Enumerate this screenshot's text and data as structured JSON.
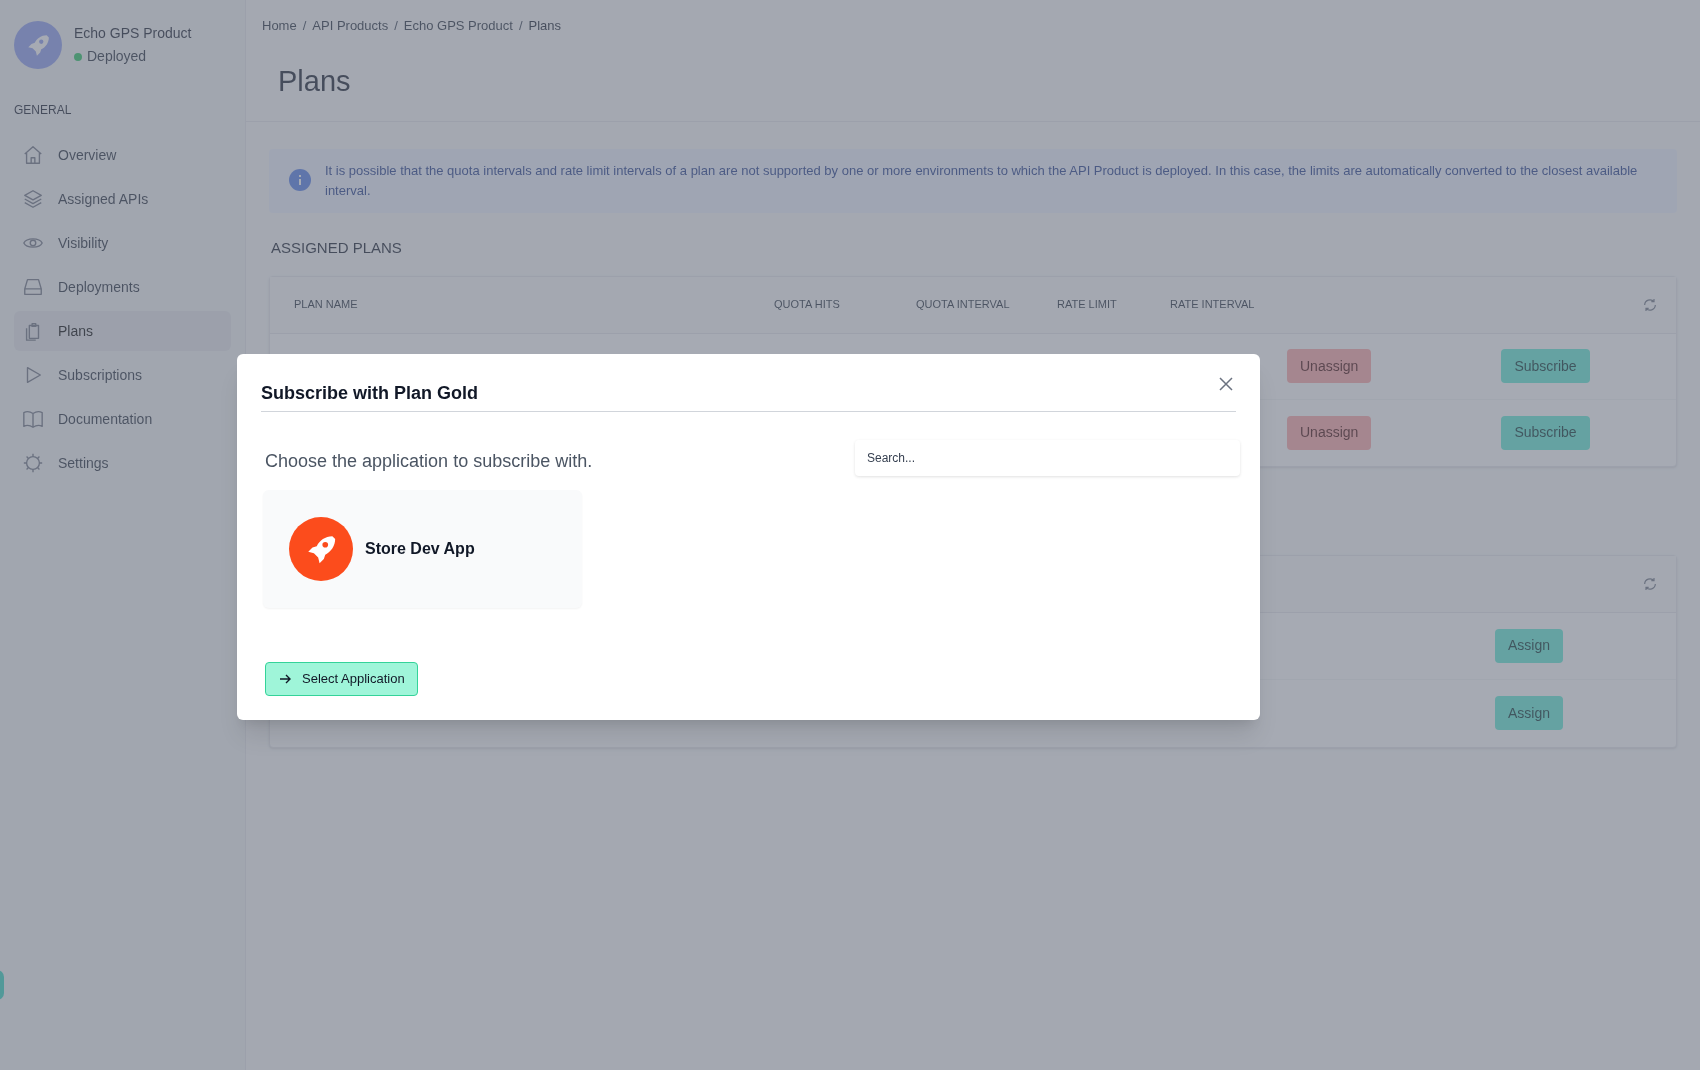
{
  "product": {
    "name": "Echo GPS Product",
    "status": "Deployed"
  },
  "sidebar": {
    "section": "GENERAL",
    "items": [
      {
        "label": "Overview",
        "selected": false
      },
      {
        "label": "Assigned APIs",
        "selected": false
      },
      {
        "label": "Visibility",
        "selected": false
      },
      {
        "label": "Deployments",
        "selected": false
      },
      {
        "label": "Plans",
        "selected": true
      },
      {
        "label": "Subscriptions",
        "selected": false
      },
      {
        "label": "Documentation",
        "selected": false
      },
      {
        "label": "Settings",
        "selected": false
      }
    ]
  },
  "breadcrumb": [
    {
      "text": "Home",
      "kind": "link"
    },
    {
      "text": "/",
      "kind": "separator"
    },
    {
      "text": "API Products",
      "kind": "link"
    },
    {
      "text": "/",
      "kind": "separator"
    },
    {
      "text": "Echo GPS Product",
      "kind": "link"
    },
    {
      "text": "/",
      "kind": "separator"
    },
    {
      "text": "Plans",
      "kind": "current"
    }
  ],
  "page_title": "Plans",
  "info": "It is possible that the quota intervals and rate limit intervals of a plan are not supported by one or more environments to which the API Product is deployed. In this case, the limits are automatically converted to the closest available interval.",
  "assigned_plans": {
    "title": "ASSIGNED PLANS",
    "columns": [
      "PLAN NAME",
      "QUOTA HITS",
      "QUOTA INTERVAL",
      "RATE LIMIT",
      "RATE INTERVAL"
    ],
    "rows": [
      {
        "actions": [
          "Unassign",
          "Subscribe"
        ]
      },
      {
        "actions": [
          "Unassign",
          "Subscribe"
        ]
      }
    ]
  },
  "other_plans": {
    "rows": [
      {
        "actions": [
          "Assign"
        ]
      },
      {
        "actions": [
          "Assign"
        ]
      }
    ]
  },
  "modal": {
    "title": "Subscribe with Plan Gold",
    "prompt": "Choose the application to subscribe with.",
    "search": {
      "placeholder": "Search..."
    },
    "applications": [
      {
        "name": "Store Dev App",
        "color": "#fc4c1c"
      }
    ],
    "button": "Select Application"
  }
}
